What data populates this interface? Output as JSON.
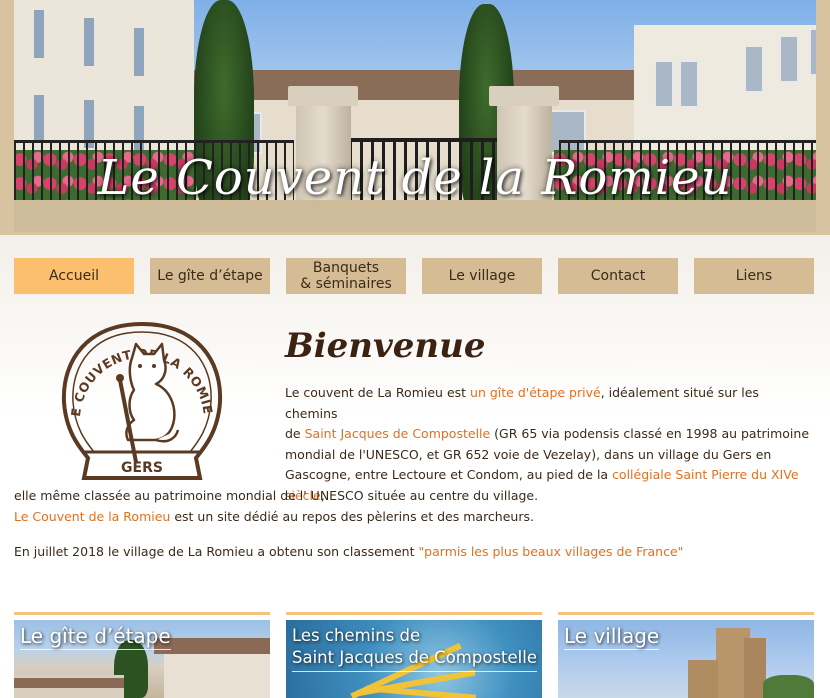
{
  "header": {
    "site_title": "Le Couvent de la Romieu"
  },
  "nav": {
    "items": [
      {
        "label": "Accueil",
        "active": true
      },
      {
        "label": "Le gîte d’étape"
      },
      {
        "label_line1": "Banquets",
        "label_line2": "& séminaires"
      },
      {
        "label": "Le village"
      },
      {
        "label": "Contact"
      },
      {
        "label": "Liens"
      }
    ]
  },
  "logo": {
    "top_text": "LE COUVENT DE LA ROMIEU",
    "bottom_text": "GERS"
  },
  "main": {
    "heading": "Bienvenue",
    "p1": {
      "t1": "Le couvent de La Romieu est ",
      "l1": "un gîte d'étape privé",
      "t2": ", idéalement situé sur les chemins",
      "t3": "de ",
      "l2": "Saint Jacques de Compostelle",
      "t4": " (GR 65 via podensis classé en 1998 au patrimoine",
      "t5": "mondial de l'UNESCO, et GR 652 voie de Vezelay), dans un village du Gers en",
      "t6": "Gascogne, entre Lectoure et Condom, au pied de la ",
      "l3a": "collégiale Saint Pierre du XIVe",
      "l3b": "siècle",
      "t7": ",",
      "t8": "elle même classée au patrimoine mondial de l' UNESCO située au centre du village.",
      "l4": "Le Couvent de la Romieu",
      "t9": " est un site dédié au repos des pèlerins et des marcheurs."
    },
    "p2": {
      "t1": "En juillet 2018 le village de La Romieu a obtenu son classement ",
      "l1": "\"parmis les plus beaux villages de France\""
    }
  },
  "cards": [
    {
      "title": "Le gîte d’étape"
    },
    {
      "title_line1": "Les chemins de",
      "title_line2": "Saint Jacques de Compostelle"
    },
    {
      "title": "Le village"
    }
  ],
  "colors": {
    "nav_bg": "#d5bc94",
    "nav_active": "#fbbf6e",
    "link": "#e2701f",
    "card_border": "#f4c27c"
  }
}
